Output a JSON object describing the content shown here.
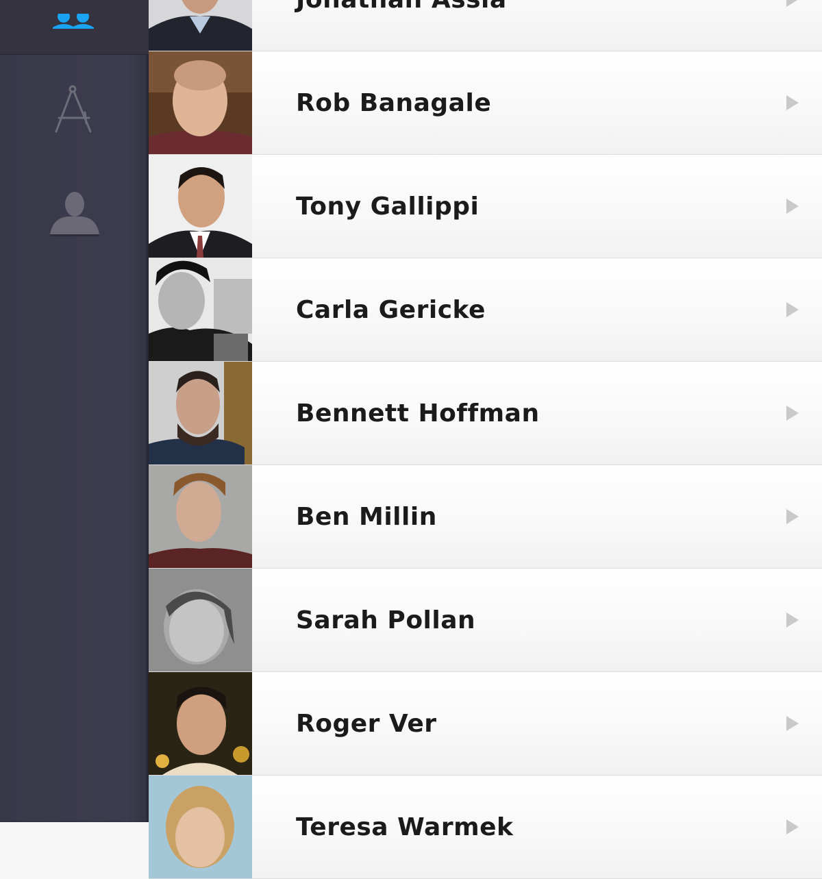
{
  "sidebar": {
    "items": [
      {
        "icon": "people-icon",
        "active": true,
        "color": "#1aa3f0"
      },
      {
        "icon": "compass-drafting-icon",
        "active": false
      },
      {
        "icon": "person-icon",
        "active": false
      }
    ]
  },
  "contacts": [
    {
      "name": "Jonathan Assia"
    },
    {
      "name": "Rob Banagale"
    },
    {
      "name": "Tony Gallippi"
    },
    {
      "name": "Carla Gericke"
    },
    {
      "name": "Bennett Hoffman"
    },
    {
      "name": "Ben Millin"
    },
    {
      "name": "Sarah Pollan"
    },
    {
      "name": "Roger Ver"
    },
    {
      "name": "Teresa Warmek"
    }
  ],
  "accent_color": "#1aa3f0"
}
